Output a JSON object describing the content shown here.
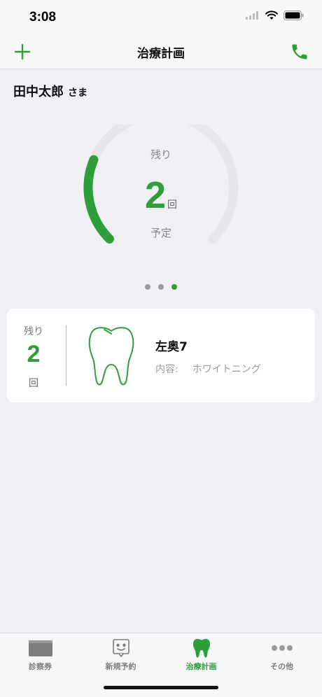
{
  "status_bar": {
    "time": "3:08"
  },
  "nav": {
    "title": "治療計画"
  },
  "patient": {
    "name": "田中太郎",
    "suffix": "さま"
  },
  "gauge": {
    "label_top": "残り",
    "value": "2",
    "unit": "回",
    "label_bottom": "予定",
    "progress_fraction": 0.25,
    "accent_color": "#2e9e3a",
    "track_color": "#e5e5ea"
  },
  "pager": {
    "pages": 3,
    "active_index": 2
  },
  "treatment_card": {
    "remain_label": "残り",
    "remain_value": "2",
    "remain_unit": "回",
    "icon": "tooth-icon",
    "title": "左奥7",
    "content_label": "内容:",
    "content_value": "ホワイトニング"
  },
  "tabs": [
    {
      "label": "診察券",
      "icon": "card-icon",
      "active": false
    },
    {
      "label": "新規予約",
      "icon": "calendar-face-icon",
      "active": false
    },
    {
      "label": "治療計画",
      "icon": "tooth-icon",
      "active": true
    },
    {
      "label": "その他",
      "icon": "more-dots-icon",
      "active": false
    }
  ]
}
